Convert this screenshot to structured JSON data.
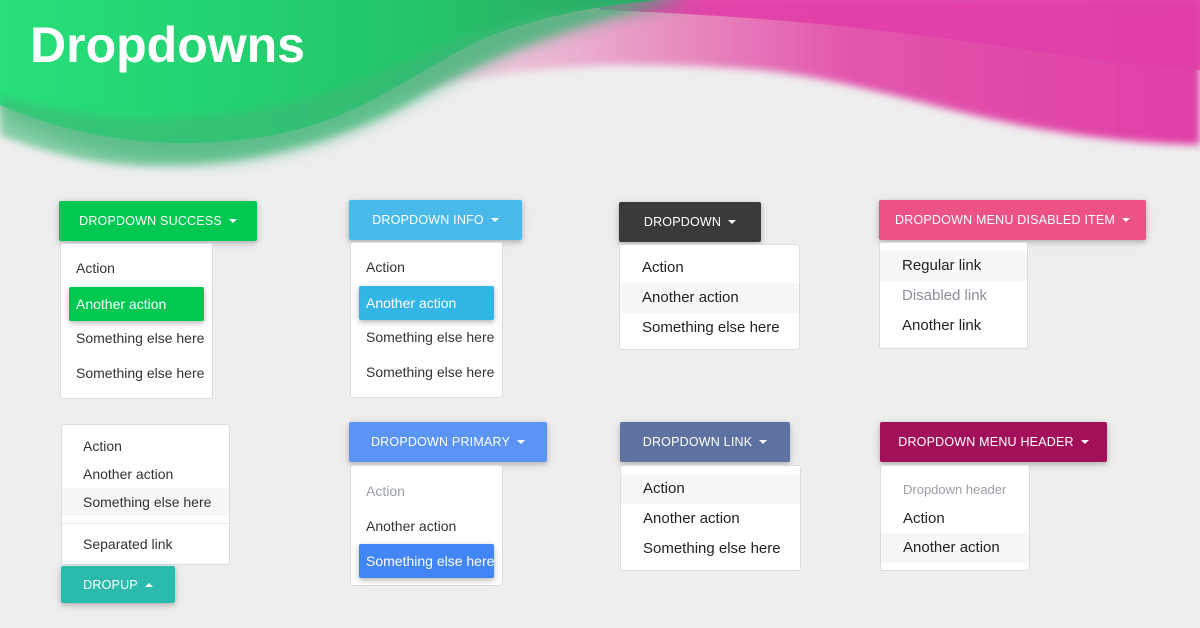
{
  "title": "Dropdowns",
  "colors": {
    "success": "#00c851",
    "info": "#48b9e8",
    "dark": "#3a3a3a",
    "pink": "#ec5286",
    "teal": "#2bbbad",
    "primary": "#5a95f5",
    "primary_active": "#4285f4",
    "link": "#5d72a0",
    "header_btn": "#a2105a",
    "info_active": "#33b5e5"
  },
  "dropdowns": [
    {
      "button": "Dropdown Success",
      "items": [
        "Action",
        "Another action",
        "Something else here",
        "Something else here"
      ],
      "active_index": 1
    },
    {
      "button": "Dropdown Info",
      "items": [
        "Action",
        "Another action",
        "Something else here",
        "Something else here"
      ],
      "active_index": 1
    },
    {
      "button": "Dropdown",
      "items": [
        "Action",
        "Another action",
        "Something else here"
      ],
      "hover_index": 1
    },
    {
      "button": "Dropdown Menu Disabled Item",
      "items": [
        "Regular link",
        "Disabled link",
        "Another link"
      ],
      "hover_index": 0,
      "disabled_index": 1
    },
    {
      "button": "Dropup",
      "items": [
        "Action",
        "Another action",
        "Something else here"
      ],
      "separated_item": "Separated link",
      "hover_index": 2
    },
    {
      "button": "Dropdown Primary",
      "items": [
        "Action",
        "Another action",
        "Something else here"
      ],
      "disabled_index": 0,
      "active_index": 2
    },
    {
      "button": "Dropdown Link",
      "items": [
        "Action",
        "Another action",
        "Something else here"
      ],
      "hover_index": 0
    },
    {
      "button": "Dropdown Menu Header",
      "header": "Dropdown header",
      "items": [
        "Action",
        "Another action"
      ],
      "hover_index": 1
    }
  ]
}
